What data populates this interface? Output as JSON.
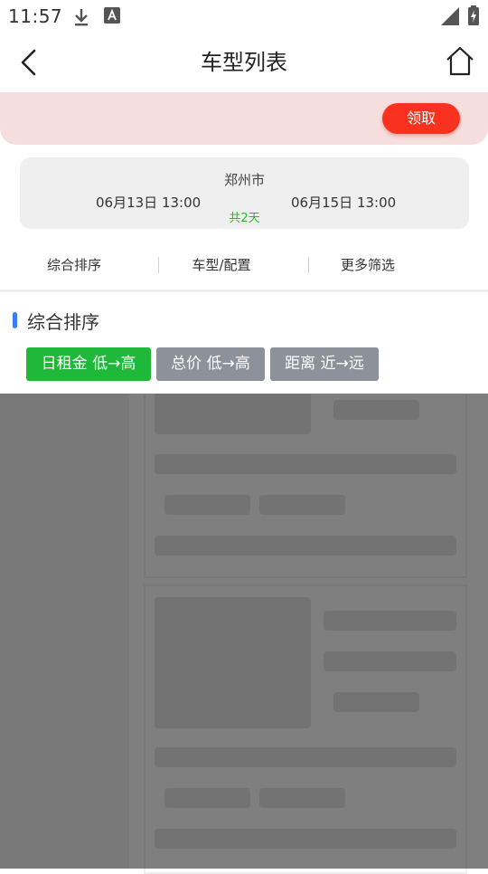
{
  "status_bar": {
    "time": "11:57",
    "icons": [
      "download-icon",
      "font-a-icon",
      "signal-icon",
      "battery-charging-icon"
    ]
  },
  "header": {
    "title": "车型列表",
    "back_icon": "chevron-left-icon",
    "home_icon": "home-icon"
  },
  "banner": {
    "claim_label": "领取",
    "accent_color": "#f8321e",
    "background_color": "#f7dede"
  },
  "rental_info": {
    "city": "郑州市",
    "start": "06月13日 13:00",
    "end": "06月15日 13:00",
    "duration": "共2天"
  },
  "filters": {
    "tabs": [
      "综合排序",
      "车型/配置",
      "更多筛选"
    ]
  },
  "sort_panel": {
    "title": "综合排序",
    "options": [
      {
        "label": "日租金 低→高",
        "active": true
      },
      {
        "label": "总价 低→高",
        "active": false
      },
      {
        "label": "距离 近→远",
        "active": false
      }
    ],
    "active_color": "#1fb83a",
    "idle_color": "#8c919a"
  }
}
